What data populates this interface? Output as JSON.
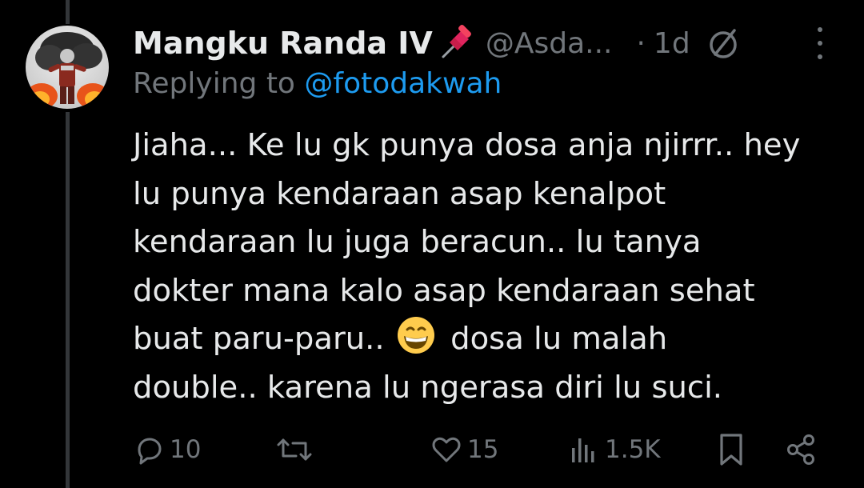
{
  "tweet": {
    "display_name": "Mangku Randa IV",
    "badge_icon": "pushpin-icon",
    "handle": "@Asda...",
    "separator": "·",
    "time": "1d",
    "replying_prefix": "Replying to ",
    "replying_handle": "@fotodakwah",
    "text_before_emoji": "Jiaha... Ke lu gk punya dosa anja njirrr.. hey\nlu punya kendaraan asap kenalpot\nkendaraan lu juga beracun.. lu tanya\ndokter mana kalo asap kendaraan sehat\nbuat paru-paru..",
    "emoji": "grinning-face-emoji",
    "text_after_emoji": "dosa lu malah\ndouble.. karena lu ngerasa diri lu suci."
  },
  "actions": {
    "reply_count": "10",
    "retweet_count": "",
    "like_count": "15",
    "views_count": "1.5K"
  },
  "colors": {
    "background": "#000000",
    "text": "#e7e9ea",
    "secondary": "#71767b",
    "link": "#1d9bf0",
    "thread_line": "#333639"
  }
}
